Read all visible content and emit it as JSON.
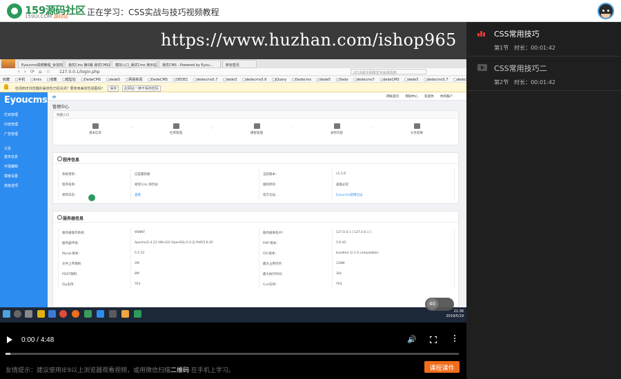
{
  "header": {
    "logo_name": "159源码社区",
    "logo_sub": "159UI.COM",
    "logo_sub_accent": "源码站",
    "now_learning": "正在学习：CSS实战与技巧视频教程"
  },
  "video": {
    "watermark": "https://www.huzhan.com/ishop965",
    "browser": {
      "tabs": [
        "Eyoucms视频教程_余曾的导出...",
        "易优Cms 第0版 易优CMS后台",
        "模块入口_易优Cms 演示站",
        "易优CMS - Powered by Eyou...",
        "新标签页"
      ],
      "url": "127.0.0.1/login.php",
      "search_placeholder": "2018最全网络安全操准指南",
      "nav_glyphs": "‹ › ⟳ ⌂ ☆",
      "bookmarks": "收藏 ▢手机 ▢links ▢收藏 ▢模型站 ▢DedeCMS ▢dede5 ▢网易新闻 ▢DedeCMS ▢DEDE1 ▢dedecms5.7 ▢dede3 ▢dedecms5.6 ▢jQuery ▢Dedecms ▢dede5 ▢Dede ▢dedecms7 ▢dedeCMS ▢dede5 ▢dedecms5.7 ▢dede3",
      "notice": "检测到IE浏览器的兼容性已经关闭？要使用兼容性视图吗？",
      "notice_btn1": "保存",
      "notice_btn2": "此网站一律不保存密码"
    },
    "cms": {
      "logo": "Eyoucms",
      "sidebar_items": [
        "栏目管理",
        "内容管理",
        "广告管理"
      ],
      "sidebar_group": "设置",
      "sidebar_items2": [
        "基本信息",
        "可视编辑",
        "模板设置",
        "高级选项"
      ],
      "top_links": "网站首页 帮助中心 欢迎你 你的账户",
      "breadcrumb": "管理中心",
      "quick_title": "快捷入口",
      "quick_items": [
        "基本信息",
        "栏目管理",
        "模板管理",
        "发布内容",
        "分享成果"
      ],
      "program_panel_title": "程序信息",
      "program_rows": [
        [
          "系统更新：",
          "已是最新版",
          "当前版本：",
          "v1.1.6"
        ],
        [
          "程序名称：",
          "易优Cms 演示站",
          "版权所有：",
          "盗版必究"
        ],
        [
          "更新日志：",
          "查看",
          "官方论坛：",
          "Eyoucms官网论坛"
        ]
      ],
      "server_panel_title": "服务器信息",
      "server_rows": [
        [
          "服务器操作系统：",
          "WINNT",
          "服务器域名/IP：",
          "127.0.0.1 [ 127.0.0.1 ]"
        ],
        [
          "服务器环境：",
          "Apache/2.4.23 (Win32) OpenSSL/1.0.2j PHP/5.6.45",
          "PHP 版本：",
          "5.6.45"
        ],
        [
          "Mysql 版本：",
          "5.5.53",
          "GD 版本：",
          "bundled (2.1.0 compatible)"
        ],
        [
          "文件上传限制：",
          "2M",
          "最大占用内存：",
          "128M"
        ],
        [
          "POST限制：",
          "8M",
          "最大执行时间：",
          "30s"
        ],
        [
          "Zip支持：",
          "YES",
          "Curl支持：",
          "YES"
        ]
      ]
    },
    "taskbar": {
      "time": "21:38",
      "date": "2019/5/19"
    },
    "bubble_number": "40"
  },
  "controls": {
    "time_current": "0:00",
    "time_separator": "/",
    "time_total": "4:48",
    "progress_fraction": 0.01
  },
  "footer": {
    "hint_prefix": "友情提示：建议使用IE9以上浏览器观看视频，或用微信扫描",
    "hint_bold": "二维码",
    "hint_suffix": "在手机上学习。",
    "course_button": "课程课件"
  },
  "lessons": [
    {
      "title": "CSS常用技巧",
      "section": "第1节",
      "duration": "时长：00:01:42",
      "active": true
    },
    {
      "title": "CSS常用技巧二",
      "section": "第2节",
      "duration": "时长：00:01:42",
      "active": false
    }
  ],
  "colors": {
    "accent_orange": "#f26d1a",
    "active_red": "#e53935",
    "cms_blue": "#2d8cf0",
    "logo_green": "#2b9a5b"
  }
}
